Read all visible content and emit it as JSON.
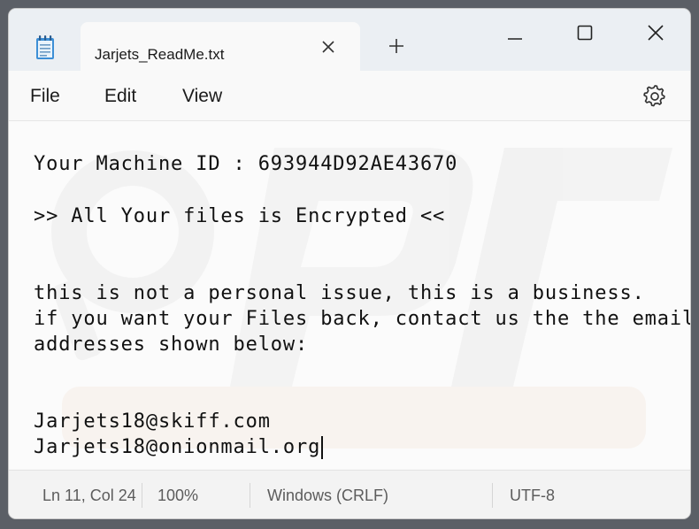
{
  "window": {
    "tab_title": "Jarjets_ReadMe.txt",
    "new_tab_symbol": "+"
  },
  "menu": {
    "file": "File",
    "edit": "Edit",
    "view": "View"
  },
  "document": {
    "lines": [
      "Your Machine ID : 693944D92AE43670",
      ">> All Your files is Encrypted <<",
      "this is not a personal issue, this is a business.",
      "if you want your Files back, contact us the the email",
      "addresses shown below:",
      "Jarjets18@skiff.com",
      "Jarjets18@onionmail.org"
    ]
  },
  "status": {
    "position": "Ln 11, Col 24",
    "zoom": "100%",
    "line_endings": "Windows (CRLF)",
    "encoding": "UTF-8"
  },
  "icons": {
    "app": "notepad-icon",
    "tab_close": "close-icon",
    "new_tab": "plus-icon",
    "minimize": "minimize-icon",
    "maximize": "maximize-icon",
    "close": "close-icon",
    "settings": "gear-icon"
  }
}
